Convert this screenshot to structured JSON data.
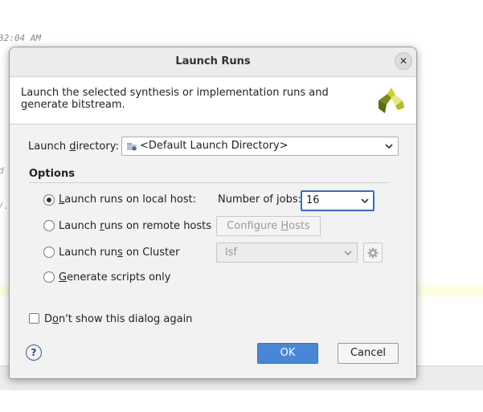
{
  "background": {
    "timestamp": "32:04 AM",
    "fragment_1": "d",
    "fragment_2": "/."
  },
  "dialog": {
    "title": "Launch Runs",
    "close_icon": "close-icon",
    "description": "Launch the selected synthesis or implementation runs and generate bitstream.",
    "logo_icon": "vivado-logo-icon",
    "launch_directory": {
      "label_pre": "Launch ",
      "label_mnemonic": "d",
      "label_post": "irectory:",
      "value": "<Default Launch Directory>",
      "icon": "folder-icon"
    },
    "options": {
      "title": "Options",
      "local": {
        "pre": "",
        "mnemonic": "L",
        "post": "aunch runs on local host:",
        "selected": true
      },
      "jobs": {
        "label": "Number of jobs:",
        "value": "16"
      },
      "remote": {
        "pre": "Launch ",
        "mnemonic": "r",
        "post": "uns on remote hosts",
        "selected": false
      },
      "configure_hosts": {
        "pre": "Configure ",
        "mnemonic": "H",
        "post": "osts"
      },
      "cluster": {
        "pre": "Launch run",
        "mnemonic": "s",
        "post": " on Cluster",
        "selected": false,
        "value": "lsf",
        "settings_icon": "gear-icon"
      },
      "scripts": {
        "pre": "",
        "mnemonic": "G",
        "post": "enerate scripts only",
        "selected": false
      }
    },
    "dont_show": {
      "pre": "D",
      "mnemonic": "o",
      "post": "n't show this dialog again",
      "checked": false
    },
    "help_label": "?",
    "ok_label": "OK",
    "cancel_label": "Cancel"
  },
  "colors": {
    "primary_button": "#4a86d6",
    "focus_border": "#2f6fc9"
  }
}
